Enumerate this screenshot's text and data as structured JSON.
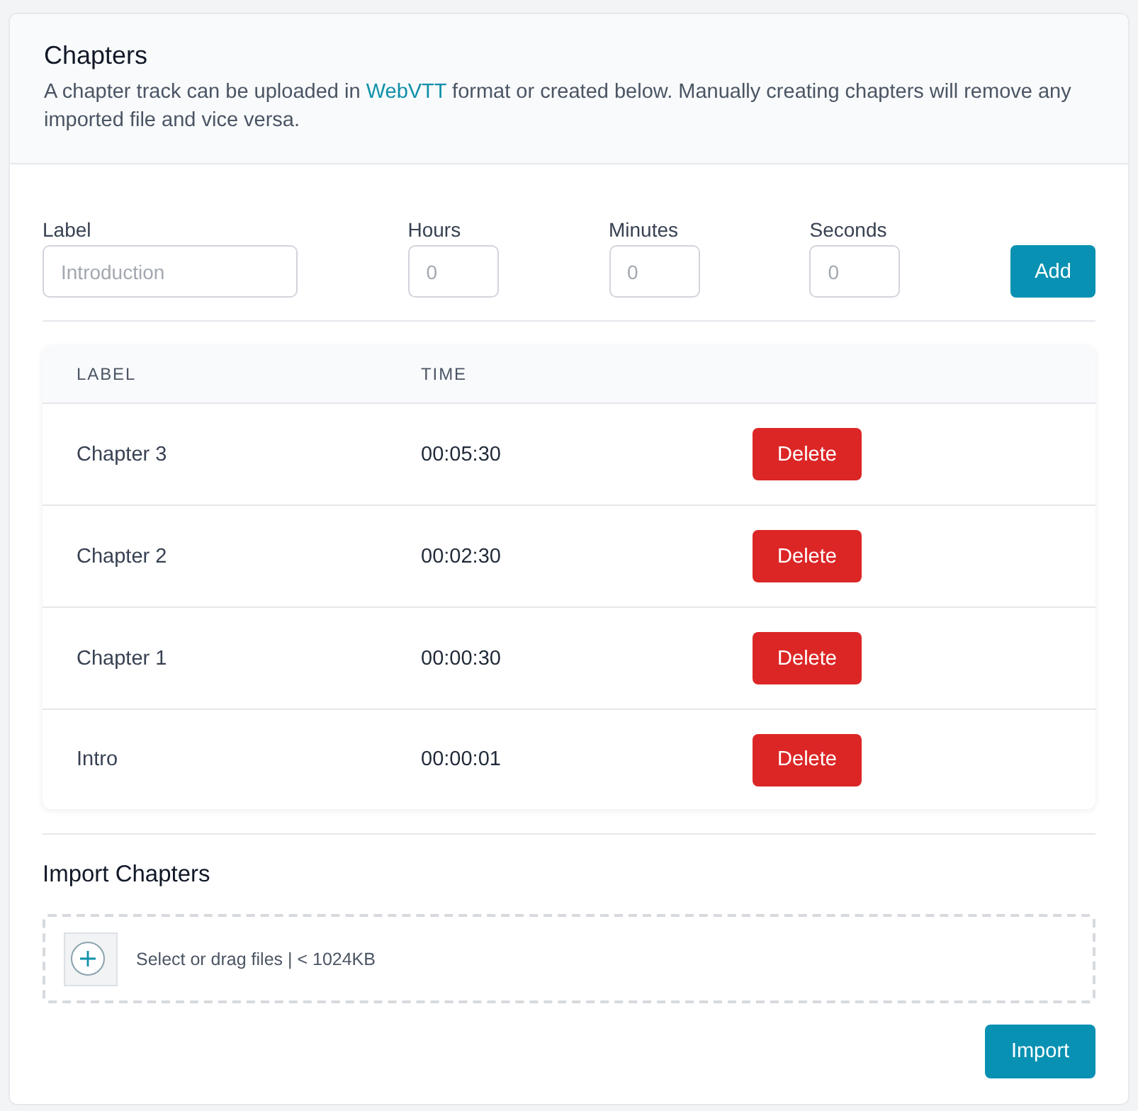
{
  "header": {
    "title": "Chapters",
    "description": [
      {
        "kind": "text",
        "text": "A chapter track can be uploaded in "
      },
      {
        "kind": "link",
        "text": "WebVTT"
      },
      {
        "kind": "text",
        "text": " format or created below. Manually creating chapters will remove any imported file and vice versa."
      }
    ]
  },
  "form": {
    "fields": [
      {
        "kind": "text",
        "label": "Label",
        "placeholder": "Introduction"
      },
      {
        "kind": "number",
        "label": "Hours",
        "placeholder": "0"
      },
      {
        "kind": "number",
        "label": "Minutes",
        "placeholder": "0"
      },
      {
        "kind": "number",
        "label": "Seconds",
        "placeholder": "0"
      }
    ],
    "add_button": "Add"
  },
  "table": {
    "columns": [
      "LABEL",
      "TIME"
    ],
    "rows": [
      {
        "label": "Chapter 3",
        "time": "00:05:30",
        "action": "Delete"
      },
      {
        "label": "Chapter 2",
        "time": "00:02:30",
        "action": "Delete"
      },
      {
        "label": "Chapter 1",
        "time": "00:00:30",
        "action": "Delete"
      },
      {
        "label": "Intro",
        "time": "00:00:01",
        "action": "Delete"
      }
    ]
  },
  "import": {
    "title": "Import Chapters",
    "dropzone": {
      "text": "Select or drag files | < 1024KB"
    },
    "button": "Import"
  }
}
